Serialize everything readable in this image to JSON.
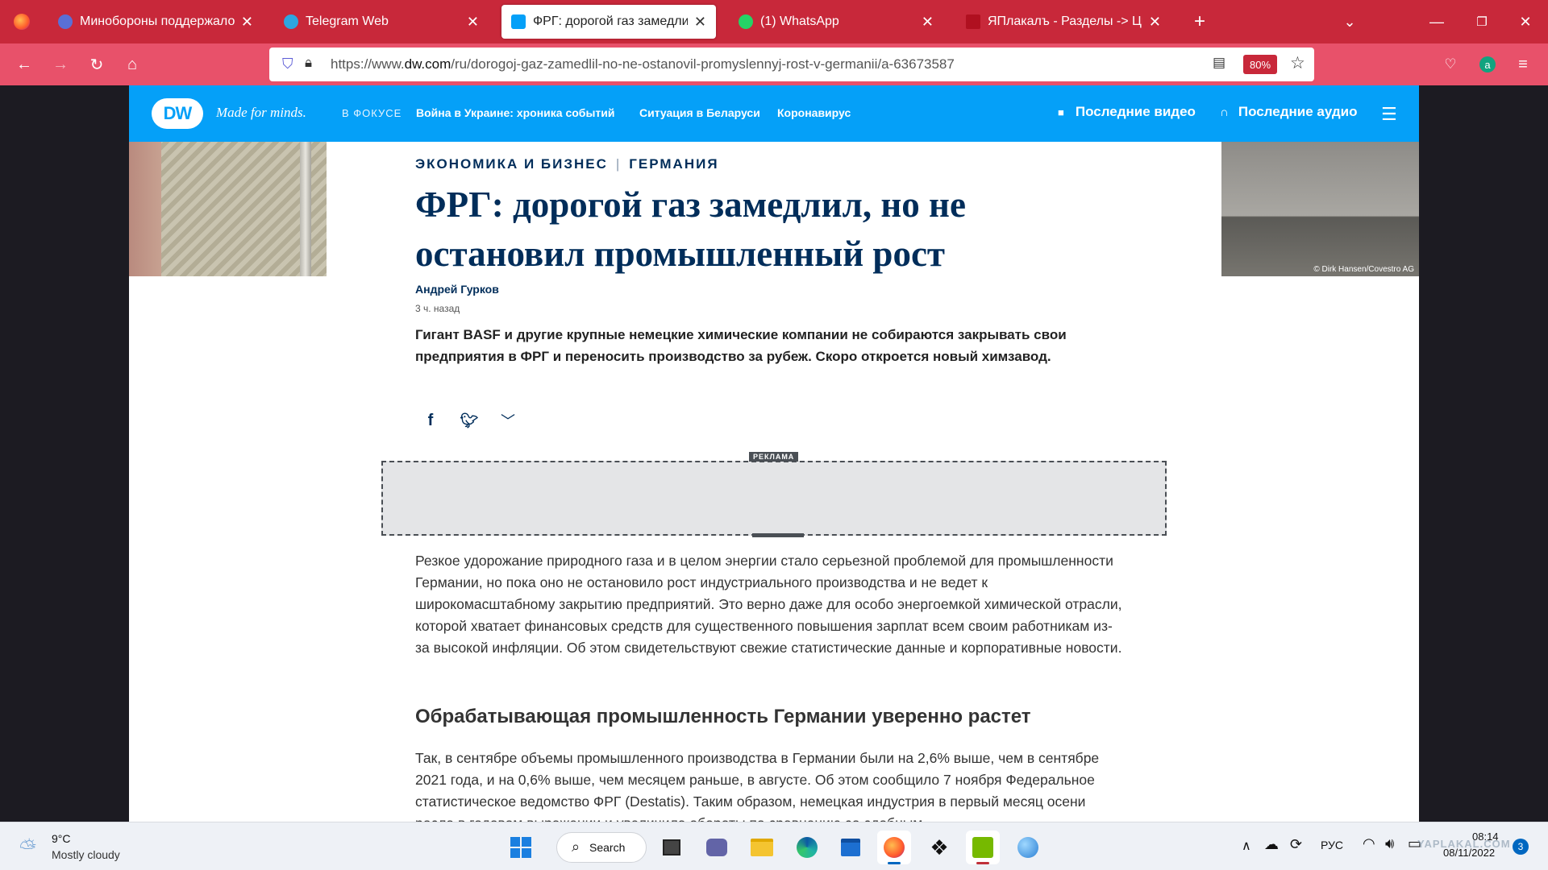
{
  "browser": {
    "tabs": [
      {
        "title": "Минобороны поддержало вве",
        "icon_color": "#5a6fd6",
        "active": false
      },
      {
        "title": "Telegram Web",
        "icon_color": "#2ea6e0",
        "active": false
      },
      {
        "title": "ФРГ: дорогой газ замедлил, но",
        "icon_color": "#05a0f8",
        "active": true
      },
      {
        "title": "(1) WhatsApp",
        "icon_color": "#25d366",
        "active": false
      },
      {
        "title": "ЯПлакалъ - Разделы -> Цитир",
        "icon_color": "#b01020",
        "active": false
      }
    ],
    "new_tab_symbol": "+",
    "close_symbol": "✕",
    "url_prefix": "https://www.",
    "url_domain": "dw.com",
    "url_path": "/ru/dorogoj-gaz-zamedlil-no-ne-ostanovil-promyslennyj-rost-v-germanii/a-63673587",
    "zoom": "80%"
  },
  "dw": {
    "logo": "DW",
    "tagline": "Made for minds.",
    "focus_label": "В ФОКУСЕ",
    "nav": [
      "Война в Украине: хроника событий",
      "Ситуация в Беларуси",
      "Коронавирус"
    ],
    "latest_video": "Последние видео",
    "latest_audio": "Последние аудио"
  },
  "article": {
    "section": "ЭКОНОМИКА И БИЗНЕС",
    "section_sep": "|",
    "country": "ГЕРМАНИЯ",
    "photo_credit": "© Dirk Hansen/Covestro AG",
    "headline_line1": "ФРГ: дорогой газ замедлил, но не",
    "headline_line2": "остановил промышленный рост",
    "author": "Андрей Гурков",
    "time": "3 ч. назад",
    "lead": "Гигант BASF и другие крупные немецкие химические компании не собираются закрывать свои предприятия в ФРГ и переносить производство за рубеж. Скоро откроется новый химзавод.",
    "ad_label": "РЕКЛАМА",
    "paragraph1": "Резкое удорожание природного газа и в целом энергии стало серьезной проблемой для промышленности Германии, но пока оно не остановило рост индустриального производства и не ведет к широкомасштабному закрытию предприятий. Это верно даже для особо энергоемкой химической отрасли, которой хватает финансовых средств для существенного повышения зарплат всем своим работникам из-за высокой инфляции. Об этом свидетельствуют свежие статистические данные и корпоративные новости.",
    "subheading": "Обрабатывающая промышленность Германии уверенно растет",
    "paragraph2": "Так, в сентябре объемы промышленного производства в Германии были на 2,6% выше, чем в сентябре 2021 года, и на 0,6% выше, чем месяцем раньше, в августе. Об этом сообщило 7 ноября Федеральное статистическое ведомство ФРГ (Destatis). Таким образом, немецкая индустрия в первый месяц осени росла в годовом выражении и увеличила обороты по сравнению со сдобным"
  },
  "taskbar": {
    "weather_temp": "9°C",
    "weather_desc": "Mostly cloudy",
    "search_label": "Search",
    "language": "РУС",
    "time": "08:14",
    "date": "08/11/2022",
    "notification_count": "3",
    "watermark": "YAPLAKAL.COM"
  }
}
